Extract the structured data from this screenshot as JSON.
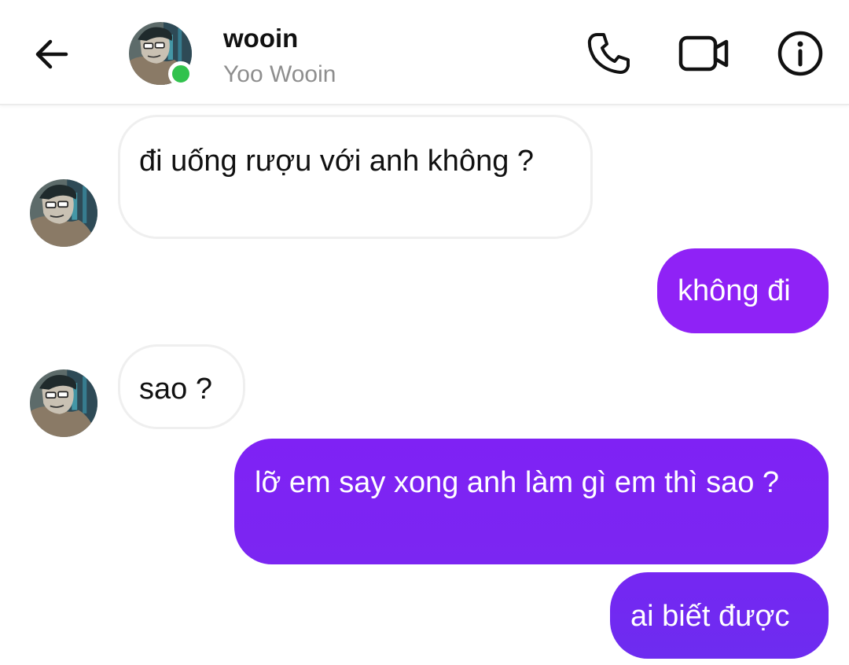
{
  "header": {
    "back_icon": "arrow-left-icon",
    "contact_name": "wooin",
    "contact_subtitle": "Yoo Wooin",
    "online_status_color": "#31c24d",
    "actions": [
      {
        "name": "call",
        "icon": "phone-icon"
      },
      {
        "name": "video",
        "icon": "video-camera-icon"
      },
      {
        "name": "info",
        "icon": "info-icon"
      }
    ]
  },
  "colors": {
    "outgoing_bubble": "#8f22f6",
    "outgoing_bubble_end": "#6d2cf0",
    "incoming_bubble_border": "#efefef"
  },
  "messages": [
    {
      "direction": "incoming",
      "text": "đi uống rượu với anh không ?"
    },
    {
      "direction": "outgoing",
      "text": "không đi"
    },
    {
      "direction": "incoming",
      "text": "sao ?"
    },
    {
      "direction": "outgoing",
      "text": "lỡ em say xong anh làm gì em thì sao ?"
    },
    {
      "direction": "outgoing",
      "text": "ai biết được"
    }
  ]
}
